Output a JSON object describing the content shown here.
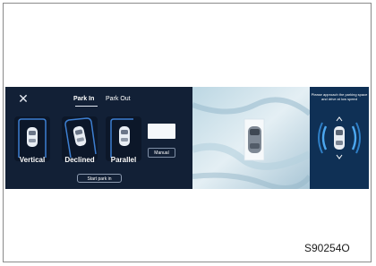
{
  "header": {
    "close_icon": "close-icon",
    "tabs": [
      {
        "label": "Park In",
        "active": true
      },
      {
        "label": "Park Out",
        "active": false
      }
    ]
  },
  "modes": [
    {
      "label": "Vertical",
      "icon": "vertical-parking-car-icon",
      "selected": false
    },
    {
      "label": "Declined",
      "icon": "declined-parking-car-icon",
      "selected": true
    },
    {
      "label": "Parallel",
      "icon": "parallel-parking-car-icon",
      "selected": false
    }
  ],
  "manual_label": "Manual",
  "start_label": "Start park in",
  "instruction_text": "Please approach the parking space and drive at low speed",
  "figure_code": "S90254O",
  "colors": {
    "panel_bg": "#122036",
    "accent_blue": "#3d7fd1",
    "text": "#ffffff"
  }
}
